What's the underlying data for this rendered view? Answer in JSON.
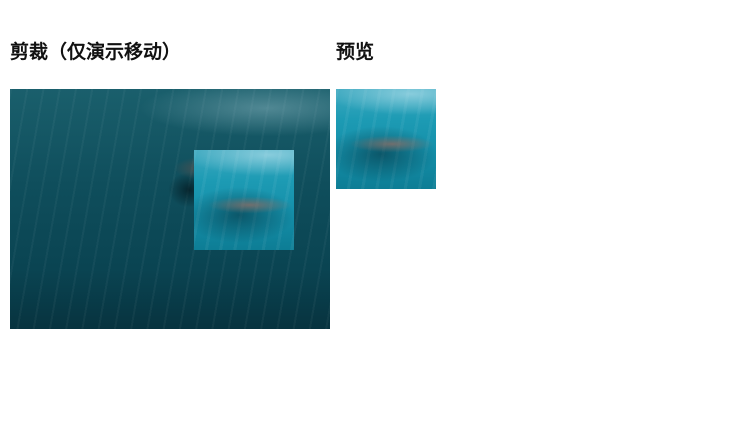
{
  "crop_section": {
    "heading": "剪裁（仅演示移动）"
  },
  "preview_section": {
    "heading": "预览"
  }
}
